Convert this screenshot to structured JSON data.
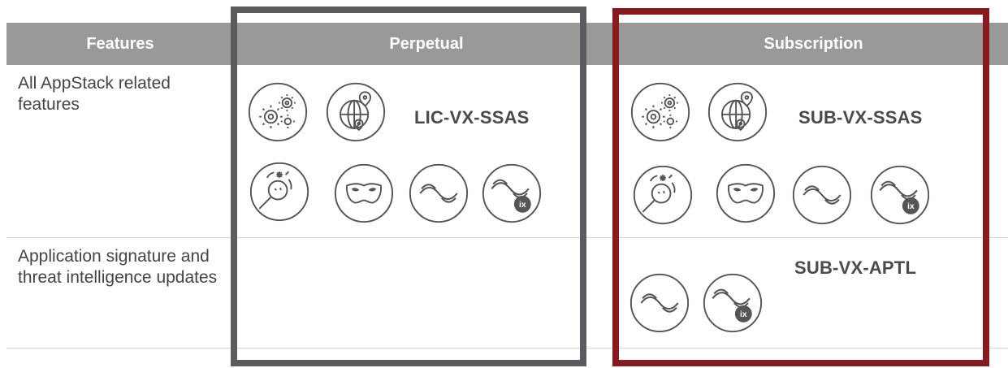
{
  "header": {
    "features": "Features",
    "perpetual": "Perpetual",
    "subscription": "Subscription"
  },
  "rows": [
    {
      "feature": "All AppStack related features",
      "perpetual_sku": "LIC-VX-SSAS",
      "subscription_sku": "SUB-VX-SSAS",
      "icons": [
        "gears-icon",
        "globe-location-icon",
        "threat-search-icon",
        "mask-icon",
        "wave-icon",
        "wave-ix-icon"
      ]
    },
    {
      "feature": "Application signature and threat intelligence updates",
      "perpetual_sku": "",
      "subscription_sku": "SUB-VX-APTL",
      "icons": [
        "wave-icon",
        "wave-ix-icon"
      ]
    }
  ],
  "badge": {
    "ix": "ix"
  },
  "colors": {
    "header_bg": "#999999",
    "perpetual_frame": "#5a5a5f",
    "subscription_frame": "#841c1f",
    "icon_stroke": "#555555"
  }
}
